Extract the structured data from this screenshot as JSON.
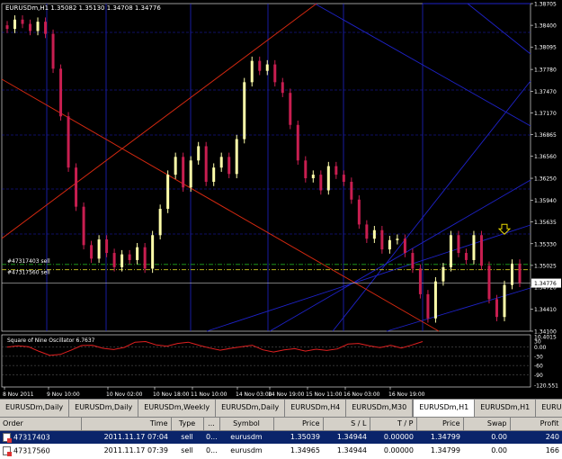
{
  "window": {
    "header": "EURUSDm,H1  1.35082 1.35130 1.34708 1.34776"
  },
  "chart_data": {
    "type": "candlestick",
    "symbol": "EURUSDm",
    "timeframe": "H1",
    "y_ticks": [
      "1.38705",
      "1.38400",
      "1.38095",
      "1.37780",
      "1.37470",
      "1.37170",
      "1.36865",
      "1.36560",
      "1.36250",
      "1.35940",
      "1.35635",
      "1.35330",
      "1.35025",
      "1.34720",
      "1.34410",
      "1.34100"
    ],
    "y_range": [
      1.341,
      1.38705
    ],
    "current_price": "1.34776",
    "current_price_value": 1.34776,
    "x_ticks": [
      "8 Nov 2011",
      "9 Nov 10:00",
      "10 Nov 02:00",
      "10 Nov 18:00",
      "11 Nov 10:00",
      "14 Nov 03:00",
      "14 Nov 19:00",
      "15 Nov 11:00",
      "16 Nov 03:00",
      "16 Nov 19:00"
    ],
    "order_lines": [
      {
        "label": "#47317403 sell",
        "price": 1.35039
      },
      {
        "label": "#47317560 sell",
        "price": 1.34965
      }
    ],
    "close_path": [
      1.3835,
      1.3848,
      1.3842,
      1.3832,
      1.3845,
      1.3828,
      1.3779,
      1.3712,
      1.364,
      1.3585,
      1.3531,
      1.3512,
      1.3539,
      1.352,
      1.35,
      1.3518,
      1.351,
      1.3528,
      1.3498,
      1.3545,
      1.3582,
      1.363,
      1.3655,
      1.3612,
      1.365,
      1.367,
      1.362,
      1.364,
      1.3655,
      1.3631,
      1.368,
      1.376,
      1.379,
      1.3776,
      1.3785,
      1.376,
      1.3745,
      1.37,
      1.365,
      1.3625,
      1.363,
      1.3608,
      1.3642,
      1.363,
      1.362,
      1.3595,
      1.356,
      1.354,
      1.3552,
      1.3525,
      1.3538,
      1.354,
      1.352,
      1.3498,
      1.3462,
      1.3428,
      1.348,
      1.35,
      1.3545,
      1.352,
      1.351,
      1.3545,
      1.3502,
      1.3455,
      1.343,
      1.3475,
      1.3505,
      1.3478
    ],
    "oscillator": {
      "title": "Square of Nine Oscillator 6.7637",
      "y_ticks": [
        "10.4015",
        "30",
        "0.00",
        "-30",
        "-60",
        "-90",
        "-120.551"
      ],
      "values": [
        0,
        4,
        1,
        -14,
        -27,
        -24,
        -10,
        5,
        6,
        -4,
        -8,
        -1,
        16,
        18,
        7,
        3,
        12,
        16,
        6,
        -3,
        -10,
        -4,
        1,
        6,
        -9,
        -16,
        -9,
        -5,
        -13,
        -7,
        -11,
        -6,
        10,
        12,
        4,
        -2,
        6,
        -3,
        7,
        18
      ]
    }
  },
  "tabs": [
    "EURUSDm,Daily",
    "EURUSDm,Daily",
    "EURUSDm,Weekly",
    "EURUSDm,Daily",
    "EURUSDm,H4",
    "EURUSDm,M30",
    "EURUSDm,H1",
    "EURUSDm,H1",
    "EURUS"
  ],
  "active_tab": 6,
  "orders": {
    "headers": [
      "Order",
      "Time",
      "Type",
      "...",
      "Symbol",
      "Price",
      "S / L",
      "T / P",
      "Price",
      "Swap",
      "Profit"
    ],
    "rows": [
      [
        "47317403",
        "2011.11.17 07:04",
        "sell",
        "0...",
        "eurusdm",
        "1.35039",
        "1.34944",
        "0.00000",
        "1.34799",
        "0.00",
        "240"
      ],
      [
        "47317560",
        "2011.11.17 07:39",
        "sell",
        "0...",
        "eurusdm",
        "1.34965",
        "1.34944",
        "0.00000",
        "1.34799",
        "0.00",
        "166"
      ]
    ]
  },
  "colors": {
    "background": "#000000",
    "bull": "#ffffaa",
    "bear": "#c81e50",
    "gann_blue": "#1e22c8",
    "gann_red": "#d22810",
    "order_green": "#22aa22",
    "order_yellow": "#b8b01e",
    "oscillator": "#e02020"
  }
}
